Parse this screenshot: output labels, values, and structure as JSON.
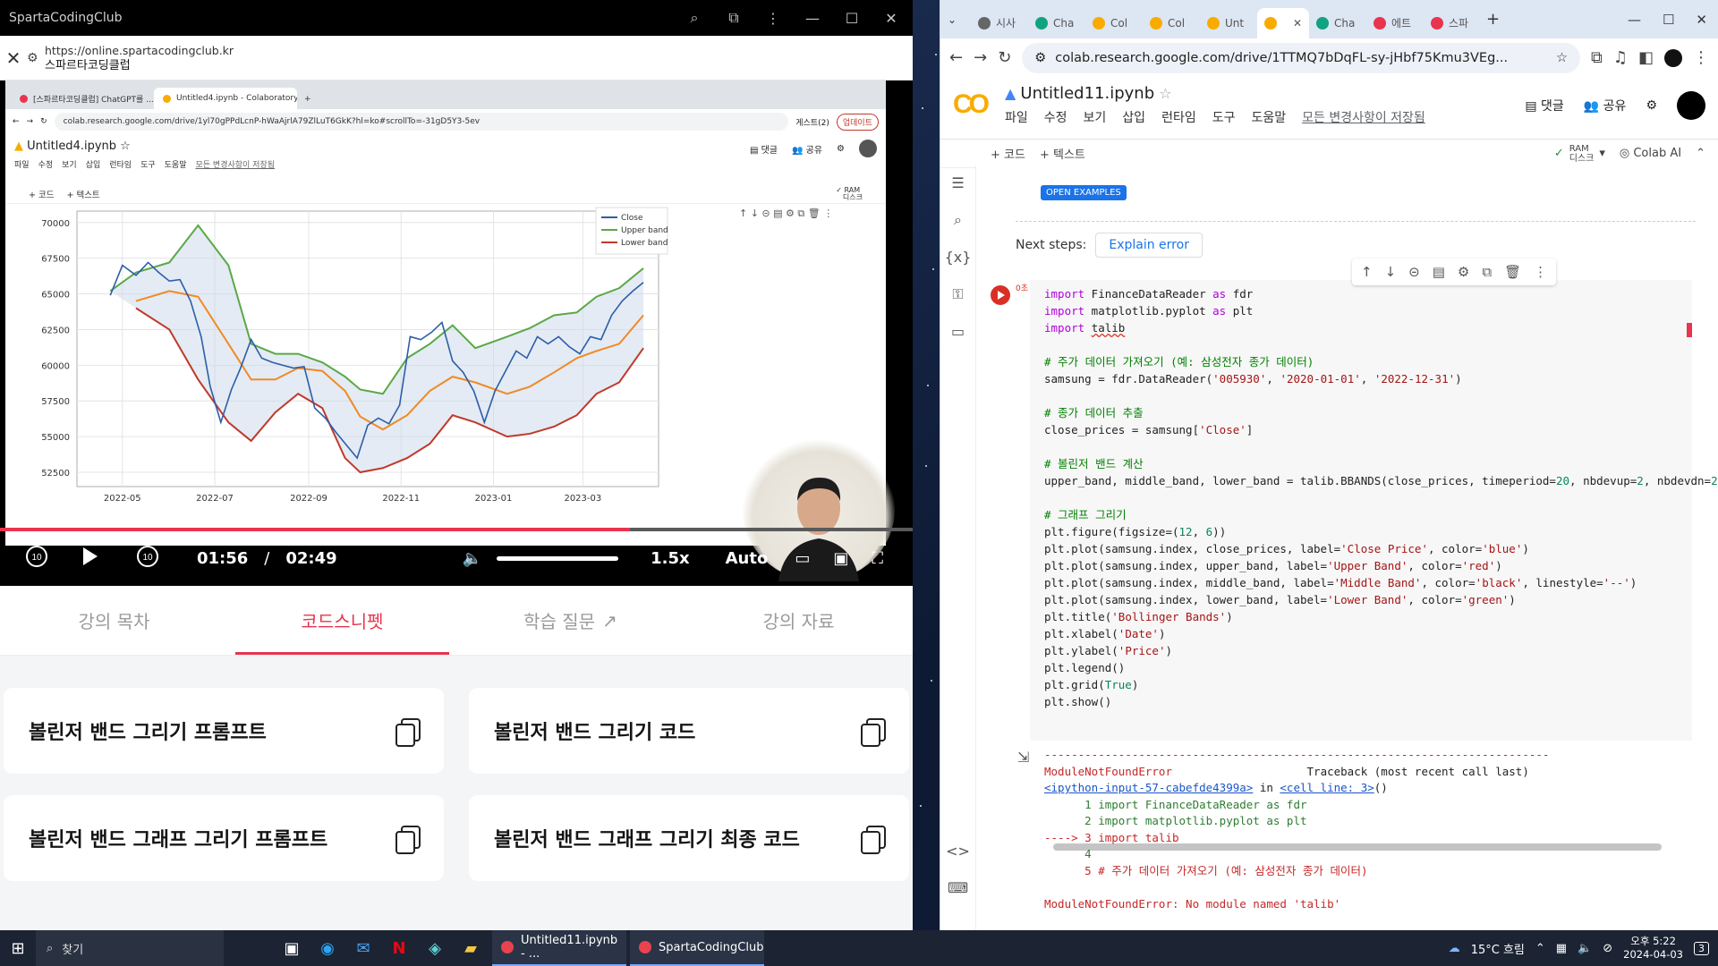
{
  "left_window": {
    "title": "SpartaCodingClub",
    "url": "https://online.spartacodingclub.kr",
    "site_name": "스파르타코딩클럽",
    "video": {
      "mini_tabs": [
        "[스파르타코딩클럽] ChatGPT를 ...",
        "Untitled4.ipynb - Colaboratory"
      ],
      "mini_url": "colab.research.google.com/drive/1yl70gPPdLcnP-hWaAjrlA79ZlLuT6GkK?hl=ko#scrollTo=-31gD5Y3-5ev",
      "mini_guest": "게스트(2)",
      "mini_update": "업데이트",
      "mini_nb_title": "Untitled4.ipynb",
      "mini_menu": [
        "파일",
        "수정",
        "보기",
        "삽입",
        "런타임",
        "도구",
        "도움말",
        "모든 변경사항이 저장됨"
      ],
      "mini_share": "공유",
      "mini_comment": "댓글",
      "mini_add_code": "+ 코드",
      "mini_add_text": "+ 텍스트",
      "mini_ram": "RAM",
      "mini_disk": "디스크",
      "current_time": "01:56",
      "separator": "/",
      "duration": "02:49",
      "speed": "1.5x",
      "quality": "Auto",
      "progress": 0.69,
      "volume": 1.0
    },
    "tabs": [
      {
        "label": "강의 목차",
        "active": false
      },
      {
        "label": "코드스니펫",
        "active": true
      },
      {
        "label": "학습 질문",
        "active": false
      },
      {
        "label": "강의 자료",
        "active": false
      }
    ],
    "snippets": [
      "볼린저 밴드 그리기 프롬프트",
      "볼린저 밴드 그리기 코드",
      "볼린저 밴드 그래프 그리기 프롬프트",
      "볼린저 밴드 그래프 그리기 최종 코드"
    ]
  },
  "chart_data": {
    "type": "line",
    "title": "",
    "xlabel": "",
    "ylabel": "",
    "ylim": [
      51500,
      70800
    ],
    "xlim": [
      "2022-04-01",
      "2023-04-20"
    ],
    "x_ticks": [
      "2022-05",
      "2022-07",
      "2022-09",
      "2022-11",
      "2023-01",
      "2023-03"
    ],
    "y_ticks": [
      52500,
      55000,
      57500,
      60000,
      62500,
      65000,
      67500,
      70000
    ],
    "legend": [
      "Close",
      "Upper band",
      "Lower band"
    ],
    "legend_position": "top-right",
    "grid": true,
    "series": [
      {
        "name": "Upper band",
        "color": "#5aa845",
        "x": [
          "2022-04-23",
          "2022-05-10",
          "2022-06-01",
          "2022-06-20",
          "2022-07-10",
          "2022-07-25",
          "2022-08-10",
          "2022-08-25",
          "2022-09-10",
          "2022-09-25",
          "2022-10-05",
          "2022-10-20",
          "2022-11-05",
          "2022-11-20",
          "2022-12-05",
          "2022-12-20",
          "2023-01-10",
          "2023-01-25",
          "2023-02-10",
          "2023-02-25",
          "2023-03-10",
          "2023-03-25",
          "2023-04-10"
        ],
        "values": [
          65200,
          66500,
          67200,
          69800,
          67000,
          61500,
          60800,
          60800,
          60200,
          59200,
          58300,
          58000,
          60500,
          61500,
          62800,
          61200,
          62000,
          62600,
          63500,
          63700,
          64800,
          65400,
          66800
        ]
      },
      {
        "name": "",
        "color": "#f08a24",
        "x": [
          "2022-05-10",
          "2022-06-01",
          "2022-06-20",
          "2022-07-10",
          "2022-07-25",
          "2022-08-10",
          "2022-08-25",
          "2022-09-10",
          "2022-09-25",
          "2022-10-05",
          "2022-10-20",
          "2022-11-05",
          "2022-11-20",
          "2022-12-05",
          "2022-12-20",
          "2023-01-10",
          "2023-01-25",
          "2023-02-10",
          "2023-02-25",
          "2023-03-10",
          "2023-03-25",
          "2023-04-10"
        ],
        "values": [
          64500,
          65200,
          64800,
          61500,
          59000,
          59000,
          59800,
          59600,
          58200,
          56400,
          55500,
          56500,
          58200,
          59200,
          58800,
          58000,
          58500,
          59500,
          60500,
          61000,
          61500,
          63500
        ]
      },
      {
        "name": "Lower band",
        "color": "#c0392b",
        "x": [
          "2022-05-10",
          "2022-06-01",
          "2022-06-20",
          "2022-07-10",
          "2022-07-25",
          "2022-08-10",
          "2022-08-25",
          "2022-09-10",
          "2022-09-25",
          "2022-10-05",
          "2022-10-20",
          "2022-11-05",
          "2022-11-20",
          "2022-12-05",
          "2022-12-20",
          "2023-01-10",
          "2023-01-25",
          "2023-02-10",
          "2023-02-25",
          "2023-03-10",
          "2023-03-25",
          "2023-04-10"
        ],
        "values": [
          64000,
          62500,
          59000,
          56000,
          54700,
          56700,
          58000,
          57000,
          53500,
          52500,
          52800,
          53500,
          54500,
          56500,
          56000,
          55000,
          55200,
          55700,
          56500,
          58000,
          58800,
          61200
        ]
      },
      {
        "name": "Close",
        "color": "#2c5ea8",
        "x": [
          "2022-04-23",
          "2022-05-01",
          "2022-05-10",
          "2022-05-18",
          "2022-05-25",
          "2022-06-01",
          "2022-06-08",
          "2022-06-15",
          "2022-06-22",
          "2022-06-28",
          "2022-07-05",
          "2022-07-12",
          "2022-07-18",
          "2022-07-25",
          "2022-08-01",
          "2022-08-08",
          "2022-08-15",
          "2022-08-22",
          "2022-08-29",
          "2022-09-05",
          "2022-09-12",
          "2022-09-19",
          "2022-09-26",
          "2022-10-03",
          "2022-10-10",
          "2022-10-17",
          "2022-10-24",
          "2022-10-31",
          "2022-11-07",
          "2022-11-14",
          "2022-11-21",
          "2022-11-28",
          "2022-12-05",
          "2022-12-12",
          "2022-12-19",
          "2022-12-26",
          "2023-01-02",
          "2023-01-09",
          "2023-01-16",
          "2023-01-23",
          "2023-01-30",
          "2023-02-06",
          "2023-02-13",
          "2023-02-20",
          "2023-02-27",
          "2023-03-06",
          "2023-03-13",
          "2023-03-20",
          "2023-03-27",
          "2023-04-03",
          "2023-04-10"
        ],
        "values": [
          64900,
          67000,
          66300,
          67200,
          66500,
          65900,
          66000,
          64500,
          62000,
          58500,
          56000,
          58300,
          59800,
          61800,
          60500,
          60200,
          60000,
          59800,
          59900,
          57000,
          56300,
          55300,
          54400,
          53500,
          55800,
          56300,
          55900,
          57200,
          62000,
          61800,
          62300,
          63000,
          60300,
          59500,
          58200,
          56000,
          58200,
          59600,
          61000,
          60500,
          62000,
          61500,
          62000,
          61300,
          60800,
          62000,
          61800,
          63500,
          64500,
          65200,
          65800
        ]
      }
    ]
  },
  "right_window": {
    "tabs": [
      "시사",
      "Cha",
      "Col",
      "Col",
      "Unt",
      "",
      "Cha",
      "에트",
      "스파"
    ],
    "url": "colab.research.google.com/drive/1TTMQ7bDqFL-sy-jHbf75Kmu3VEg...",
    "notebook_title": "Untitled11.ipynb",
    "menu": [
      "파일",
      "수정",
      "보기",
      "삽입",
      "런타임",
      "도구",
      "도움말"
    ],
    "saved_status": "모든 변경사항이 저장됨",
    "comment_label": "댓글",
    "share_label": "공유",
    "add_code": "+ 코드",
    "add_text": "+ 텍스트",
    "ram_label": "RAM",
    "disk_label": "디스크",
    "colab_ai": "Colab AI",
    "open_examples": "OPEN EXAMPLES",
    "next_steps_label": "Next steps:",
    "explain_error": "Explain error",
    "exec_count": "0초",
    "code_lines": [
      "import FinanceDataReader as fdr",
      "import matplotlib.pyplot as plt",
      "import talib",
      "",
      "# 주가 데이터 가져오기 (예: 삼성전자 종가 데이터)",
      "samsung = fdr.DataReader('005930', '2020-01-01', '2022-12-31')",
      "",
      "# 종가 데이터 추출",
      "close_prices = samsung['Close']",
      "",
      "# 볼린저 밴드 계산",
      "upper_band, middle_band, lower_band = talib.BBANDS(close_prices, timeperiod=20, nbdevup=2, nbdevdn=2)",
      "",
      "# 그래프 그리기",
      "plt.figure(figsize=(12, 6))",
      "plt.plot(samsung.index, close_prices, label='Close Price', color='blue')",
      "plt.plot(samsung.index, upper_band, label='Upper Band', color='red')",
      "plt.plot(samsung.index, middle_band, label='Middle Band', color='black', linestyle='--')",
      "plt.plot(samsung.index, lower_band, label='Lower Band', color='green')",
      "plt.title('Bollinger Bands')",
      "plt.xlabel('Date')",
      "plt.ylabel('Price')",
      "plt.legend()",
      "plt.grid(True)",
      "plt.show()"
    ],
    "output": {
      "dashes": "---------------------------------------------------------------------------",
      "error_name": "ModuleNotFoundError",
      "traceback_label": "Traceback (most recent call last)",
      "input_link": "<ipython-input-57-cabefde4399a>",
      "in_text": " in ",
      "cell_line": "<cell line: 3>",
      "cell_paren": "()",
      "tb_lines": [
        "      1 import FinanceDataReader as fdr",
        "      2 import matplotlib.pyplot as plt",
        "----> 3 import talib",
        "      4 ",
        "      5 # 주가 데이터 가져오기 (예: 삼성전자 종가 데이터)"
      ],
      "final_error": "ModuleNotFoundError: No module named 'talib'"
    }
  },
  "taskbar": {
    "search": "찾기",
    "apps": [
      "Untitled11.ipynb - ...",
      "SpartaCodingClub"
    ],
    "weather": "15°C 흐림",
    "time": "오후 5:22",
    "date": "2024-04-03",
    "notifications": "3"
  }
}
